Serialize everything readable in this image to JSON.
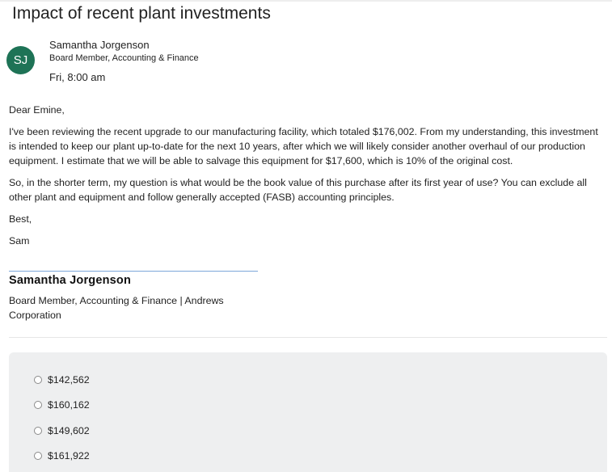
{
  "email": {
    "subject": "Impact of recent plant investments",
    "avatar_initials": "SJ",
    "avatar_color": "#1e7356",
    "sender_name": "Samantha Jorgenson",
    "sender_title": "Board Member, Accounting & Finance",
    "sent_time": "Fri, 8:00 am",
    "body": {
      "greeting": "Dear Emine,",
      "paragraph_1": "I've been reviewing the recent upgrade to our manufacturing facility, which totaled $176,002. From my understanding, this investment is intended to keep our plant up-to-date for the next 10 years, after which we will likely consider another overhaul of our production equipment. I estimate that we will be able to salvage this equipment for $17,600, which is 10% of the original cost.",
      "paragraph_2": "So, in the shorter term, my question is what would be the book value of this purchase after its first year of use? You can exclude all other plant and equipment and follow generally accepted (FASB) accounting principles.",
      "closing": "Best,",
      "sign_off": "Sam"
    },
    "signature": {
      "name": "Samantha Jorgenson",
      "title": "Board Member, Accounting & Finance | Andrews Corporation"
    }
  },
  "answer_options": [
    {
      "label": "$142,562",
      "selected": false
    },
    {
      "label": "$160,162",
      "selected": false
    },
    {
      "label": "$149,602",
      "selected": false
    },
    {
      "label": "$161,922",
      "selected": false
    }
  ]
}
